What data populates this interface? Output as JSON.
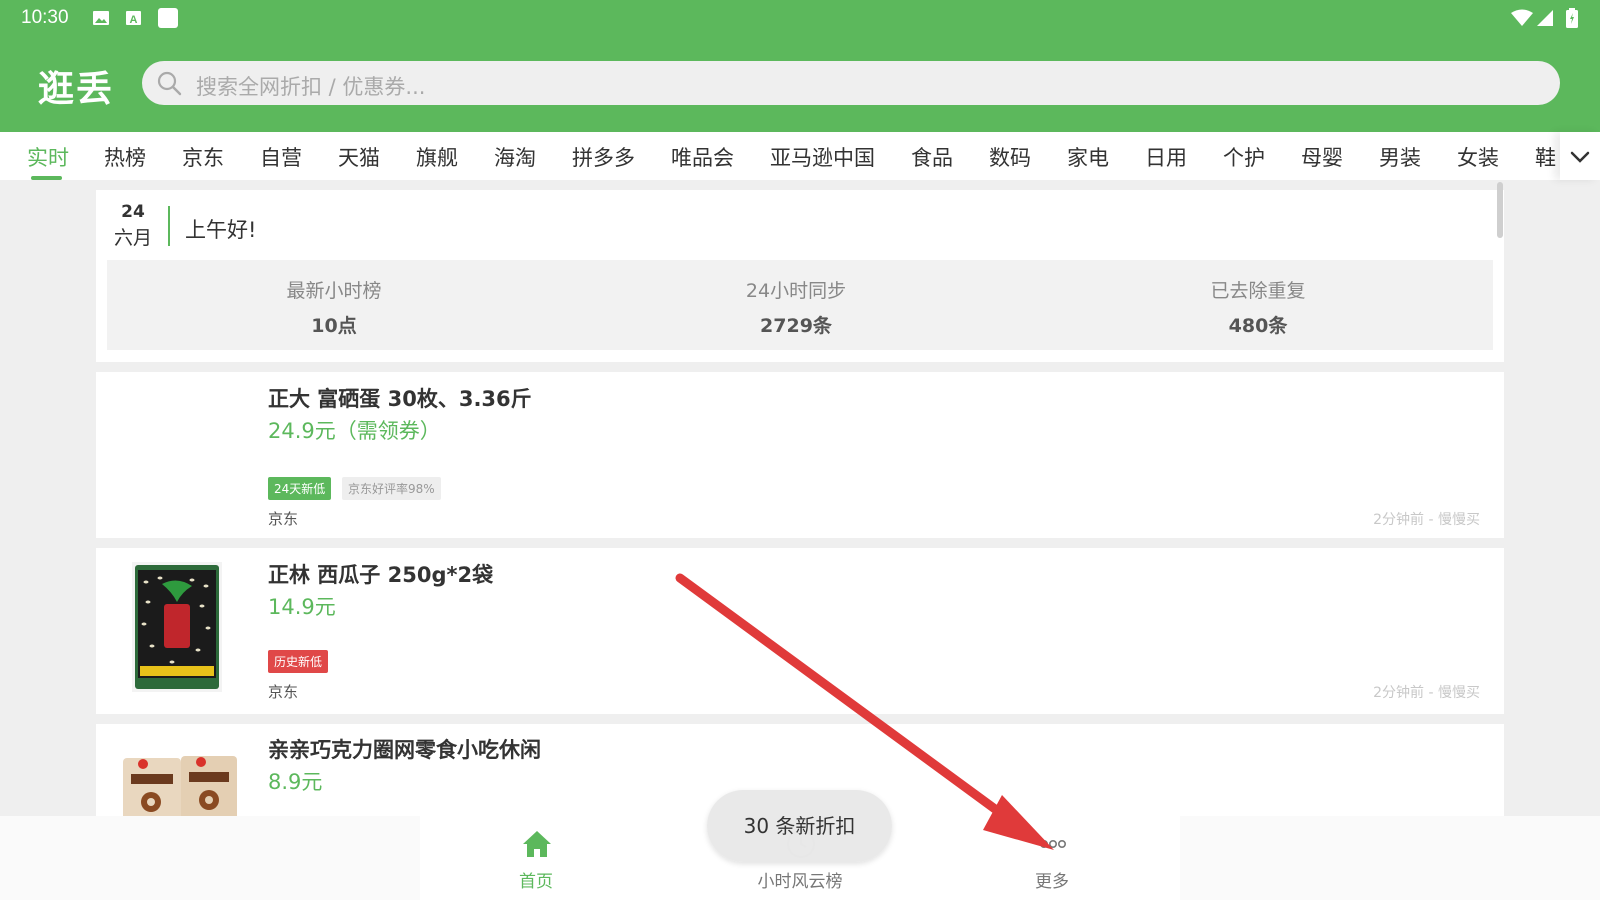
{
  "status_bar": {
    "time": "10:30",
    "icons_left": [
      "image-icon",
      "a-icon",
      "square-icon"
    ],
    "icons_right": [
      "wifi-icon",
      "signal-icon",
      "battery-icon"
    ]
  },
  "app_bar": {
    "title": "逛丢",
    "search_placeholder": "搜索全网折扣 / 优惠券..."
  },
  "tabs": [
    "实时",
    "热榜",
    "京东",
    "自营",
    "天猫",
    "旗舰",
    "海淘",
    "拼多多",
    "唯品会",
    "亚马逊中国",
    "食品",
    "数码",
    "家电",
    "日用",
    "个护",
    "母婴",
    "男装",
    "女装",
    "鞋"
  ],
  "active_tab": "实时",
  "header": {
    "day": "24",
    "month": "六月",
    "greeting": "上午好!",
    "stats": [
      {
        "label": "最新小时榜",
        "value": "10点"
      },
      {
        "label": "24小时同步",
        "value": "2729条"
      },
      {
        "label": "已去除重复",
        "value": "480条"
      }
    ]
  },
  "products": [
    {
      "title": "正大 富硒蛋 30枚、3.36斤",
      "price": "24.9元（需领券）",
      "badges": [
        {
          "text": "24天新低",
          "kind": "green"
        },
        {
          "text": "京东好评率98%",
          "kind": "gray"
        }
      ],
      "store": "京东",
      "meta": "2分钟前 - 慢慢买",
      "thumbnail": "none"
    },
    {
      "title": "正林 西瓜子 250g*2袋",
      "price": "14.9元",
      "badges": [
        {
          "text": "历史新低",
          "kind": "red"
        }
      ],
      "store": "京东",
      "meta": "2分钟前 - 慢慢买",
      "thumbnail": "seed-bag"
    },
    {
      "title": "亲亲巧克力圈网零食小吃休闲",
      "price": "8.9元",
      "badges": [],
      "store": "",
      "meta": "",
      "thumbnail": "snack-bags"
    }
  ],
  "toast": "30 条新折扣",
  "bottom_nav": [
    {
      "label": "首页",
      "icon": "home-icon",
      "active": true
    },
    {
      "label": "小时风云榜",
      "icon": "clock-icon",
      "active": false
    },
    {
      "label": "更多",
      "icon": "more-dots-icon",
      "active": false
    }
  ],
  "colors": {
    "brand_green": "#5cb85c",
    "badge_red": "#e04848",
    "annotation_arrow": "#e03a3a"
  }
}
